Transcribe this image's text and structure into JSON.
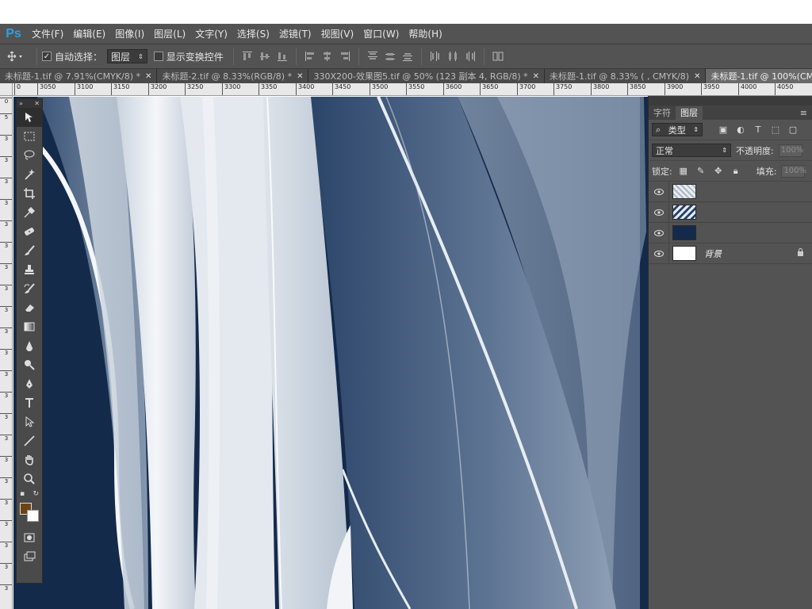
{
  "app": {
    "logo": "Ps",
    "menu": [
      "文件(F)",
      "编辑(E)",
      "图像(I)",
      "图层(L)",
      "文字(Y)",
      "选择(S)",
      "滤镜(T)",
      "视图(V)",
      "窗口(W)",
      "帮助(H)"
    ]
  },
  "options": {
    "auto_select_label": "自动选择：",
    "auto_select_checked": true,
    "auto_select_value": "图层",
    "show_transform_label": "显示变换控件",
    "show_transform_checked": false
  },
  "tabs": [
    {
      "title": "未标题-1.tif @ 7.91%(CMYK/8) *",
      "active": false
    },
    {
      "title": "未标题-2.tif @ 8.33%(RGB/8) *",
      "active": false
    },
    {
      "title": "330X200-效果图5.tif @ 50% (123 副本 4, RGB/8) *",
      "active": false
    },
    {
      "title": "未标题-1.tif @ 8.33% ( , CMYK/8)",
      "active": false
    },
    {
      "title": "未标题-1.tif @ 100%(CMYK/8)",
      "active": true
    }
  ],
  "ruler_h": [
    "0",
    "3050",
    "3100",
    "3150",
    "3200",
    "3250",
    "3300",
    "3350",
    "3400",
    "3450",
    "3500",
    "3550",
    "3600",
    "3650",
    "3700",
    "3750",
    "3800",
    "3850",
    "3900",
    "3950",
    "4000",
    "4050"
  ],
  "ruler_v": [
    "0",
    "5",
    "3",
    "3",
    "3",
    "3",
    "3",
    "3",
    "3",
    "3",
    "3",
    "3",
    "3",
    "3",
    "3",
    "3",
    "3",
    "3",
    "3",
    "3",
    "3",
    "3",
    "3",
    "3"
  ],
  "panel": {
    "tabs": [
      "字符",
      "图层"
    ],
    "active_tab": "图层",
    "filter_kind": "类型",
    "blend_mode": "正常",
    "opacity_label": "不透明度:",
    "opacity_value": "100%",
    "lock_label": "锁定:",
    "fill_label": "填充:",
    "fill_value": "100%"
  },
  "layers": [
    {
      "name": "",
      "thumb": "texture-light"
    },
    {
      "name": "",
      "thumb": "texture-blue"
    },
    {
      "name": "",
      "thumb": "solid-navy"
    },
    {
      "name": "背景",
      "thumb": "white",
      "locked": true
    }
  ],
  "colors": {
    "foreground": "#6b4415",
    "background": "#ffffff",
    "canvas_navy": "#15294a",
    "ps_blue": "#2fa0e0"
  }
}
